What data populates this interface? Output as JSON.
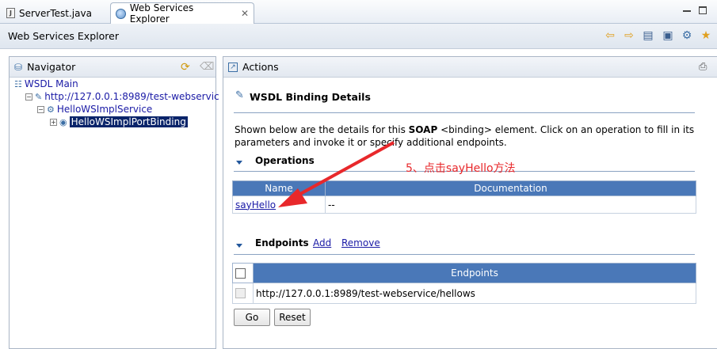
{
  "tabs": [
    {
      "label": "ServerTest.java",
      "active": false
    },
    {
      "label": "Web Services Explorer",
      "active": true
    }
  ],
  "titlebar": {
    "title": "Web Services Explorer"
  },
  "toolbar_icons": [
    "back-arrow-icon",
    "forward-arrow-icon",
    "page-icon",
    "settings-page-icon",
    "wsil-icon",
    "favorites-star-icon"
  ],
  "navigator": {
    "title": "Navigator",
    "tree": [
      {
        "label": "WSDL Main",
        "level": 0
      },
      {
        "label": "http://127.0.0.1:8989/test-webservic",
        "level": 1
      },
      {
        "label": "HelloWSImplService",
        "level": 2
      },
      {
        "label": "HelloWSImplPortBinding",
        "level": 3,
        "selected": true
      }
    ]
  },
  "actions": {
    "title": "Actions",
    "heading": "WSDL Binding Details",
    "desc_part1": "Shown below are the details for this ",
    "desc_bold": "SOAP",
    "desc_part2": " <binding> element. Click on an operation to fill in its",
    "desc_line2": "parameters and invoke it or specify additional endpoints.",
    "operations": {
      "title": "Operations",
      "columns": [
        "Name",
        "Documentation"
      ],
      "rows": [
        {
          "name": "sayHello",
          "doc": "--"
        }
      ]
    },
    "endpoints": {
      "title": "Endpoints",
      "add_label": "Add",
      "remove_label": "Remove",
      "column": "Endpoints",
      "rows": [
        "http://127.0.0.1:8989/test-webservice/hellows"
      ]
    },
    "go_label": "Go",
    "reset_label": "Reset"
  },
  "annotation": {
    "text": "5、点击sayHello方法",
    "color": "#e8282b"
  }
}
